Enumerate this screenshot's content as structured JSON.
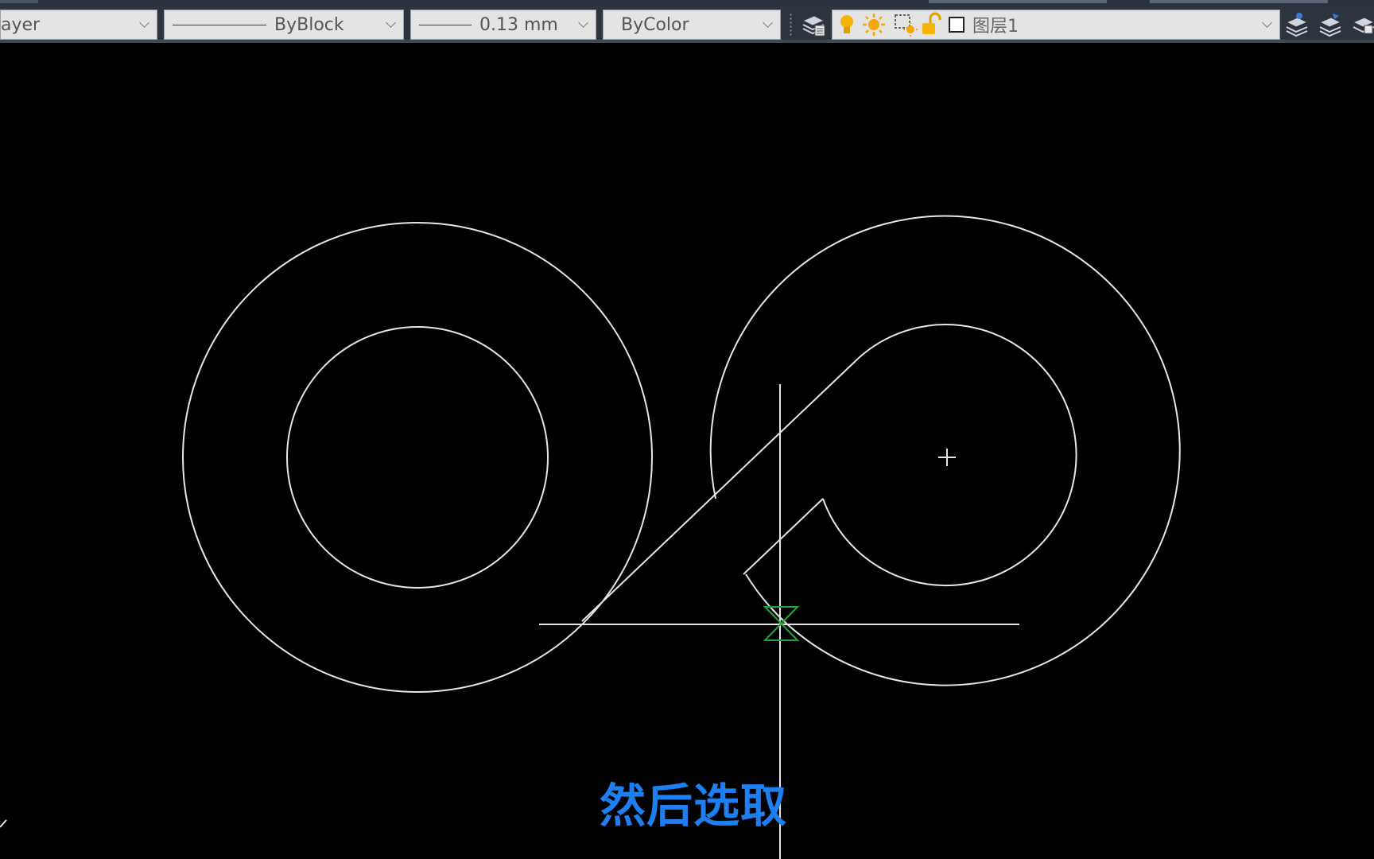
{
  "toolbar": {
    "layer_combo": {
      "value": "ayer"
    },
    "linetype_combo": {
      "value": "ByBlock"
    },
    "lineweight_combo": {
      "value": "0.13 mm"
    },
    "plotstyle_combo": {
      "value": "ByColor"
    },
    "layer_name_combo": {
      "value": "图层1"
    },
    "icons": [
      "layer-manager-icon",
      "light-bulb-icon",
      "sun-icon",
      "freeze-viewport-icon",
      "lock-icon",
      "color-swatch-icon",
      "layer-state-icon",
      "layer-previous-icon",
      "layer-isolate-icon"
    ]
  },
  "caption": {
    "text": "然后选取"
  },
  "colors": {
    "canvas": "#000000",
    "geometry": "#e6e6e6",
    "snap_marker": "#1fa53a",
    "caption": "#1e7ff0",
    "toolbar": "#2c3440"
  }
}
